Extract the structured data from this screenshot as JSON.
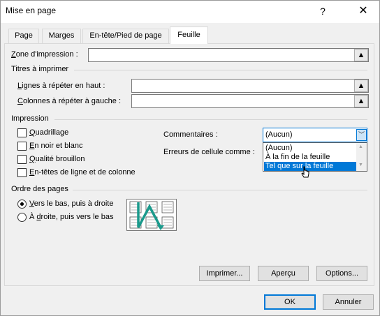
{
  "window": {
    "title": "Mise en page",
    "help": "?",
    "close": "✕"
  },
  "tabs": [
    "Page",
    "Marges",
    "En-tête/Pied de page",
    "Feuille"
  ],
  "print_area": {
    "label_pre": "Z",
    "label_rest": "one d'impression :",
    "value": ""
  },
  "titles_section": "Titres à imprimer",
  "rows_repeat": {
    "label_pre": "L",
    "label_rest": "ignes à répéter en haut :",
    "value": ""
  },
  "cols_repeat": {
    "label_pre": "C",
    "label_rest": "olonnes à répéter à gauche :",
    "value": ""
  },
  "print_section": "Impression",
  "checkboxes": [
    {
      "pre": "Q",
      "rest": "uadrillage",
      "checked": false
    },
    {
      "pre": "E",
      "rest": "n noir et blanc",
      "checked": false
    },
    {
      "pre": "Q",
      "rest": "ualité brouillon",
      "checked": false
    },
    {
      "pre": "E",
      "rest": "n-têtes de ligne et de colonne",
      "checked": false
    }
  ],
  "comments": {
    "label": "Commentaires :",
    "value": "(Aucun)",
    "options": [
      "(Aucun)",
      "À la fin de la feuille",
      "Tel que sur la feuille"
    ],
    "highlighted_index": 2
  },
  "cell_errors": {
    "label": "Erreurs de cellule comme :"
  },
  "order_section": "Ordre des pages",
  "order_options": [
    {
      "pre": "V",
      "rest": "ers le bas, puis à droite",
      "selected": true
    },
    {
      "pre": "À ",
      "u": "d",
      "rest": "roite, puis vers le bas",
      "selected": false
    }
  ],
  "panel_buttons": {
    "print": "Imprimer...",
    "preview": "Aperçu",
    "options": "Options..."
  },
  "footer_buttons": {
    "ok": "OK",
    "cancel": "Annuler"
  },
  "icons": {
    "ref": "collapse-dialog-icon",
    "arrow": "chevron-down-icon"
  },
  "colors": {
    "accent": "#0078d7",
    "highlight": "#0078d7",
    "order_arrow": "#1a9a8c"
  }
}
